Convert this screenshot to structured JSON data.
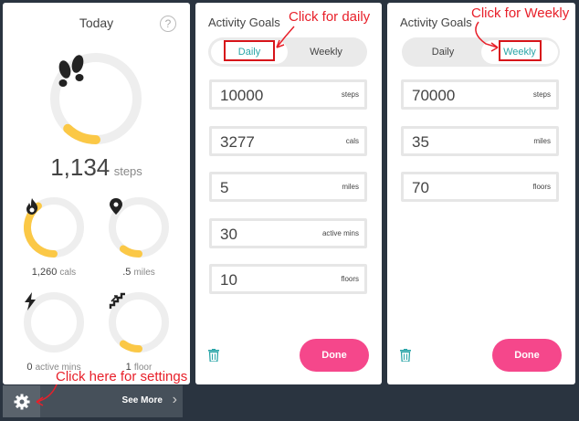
{
  "today": {
    "title": "Today",
    "help_label": "?",
    "steps": {
      "value": "1,134",
      "unit": "steps",
      "progress": 0.12
    },
    "calories": {
      "value": "1,260",
      "unit": "cals",
      "progress": 0.4
    },
    "distance": {
      "value": ".5",
      "unit": "miles",
      "progress": 0.1
    },
    "active": {
      "value": "0",
      "unit": "active mins",
      "progress": 0.0
    },
    "floors": {
      "value": "1",
      "unit": "floor",
      "progress": 0.1
    }
  },
  "bottom": {
    "see_more": "See More",
    "chevron": "›"
  },
  "daily_goals": {
    "title": "Activity Goals",
    "tabs": [
      "Daily",
      "Weekly"
    ],
    "active_tab": "Daily",
    "fields": [
      {
        "value": "10000",
        "unit": "steps"
      },
      {
        "value": "3277",
        "unit": "cals"
      },
      {
        "value": "5",
        "unit": "miles"
      },
      {
        "value": "30",
        "unit": "active mins"
      },
      {
        "value": "10",
        "unit": "floors"
      }
    ],
    "done_label": "Done"
  },
  "weekly_goals": {
    "title": "Activity Goals",
    "tabs": [
      "Daily",
      "Weekly"
    ],
    "active_tab": "Weekly",
    "fields": [
      {
        "value": "70000",
        "unit": "steps"
      },
      {
        "value": "35",
        "unit": "miles"
      },
      {
        "value": "70",
        "unit": "floors"
      }
    ],
    "done_label": "Done"
  },
  "annotations": {
    "daily": "Click for daily",
    "weekly": "Click for Weekly",
    "settings": "Click here for settings"
  },
  "colors": {
    "accent_yellow": "#fbc846",
    "accent_pink": "#f5478b",
    "accent_teal": "#2aa5a8"
  }
}
